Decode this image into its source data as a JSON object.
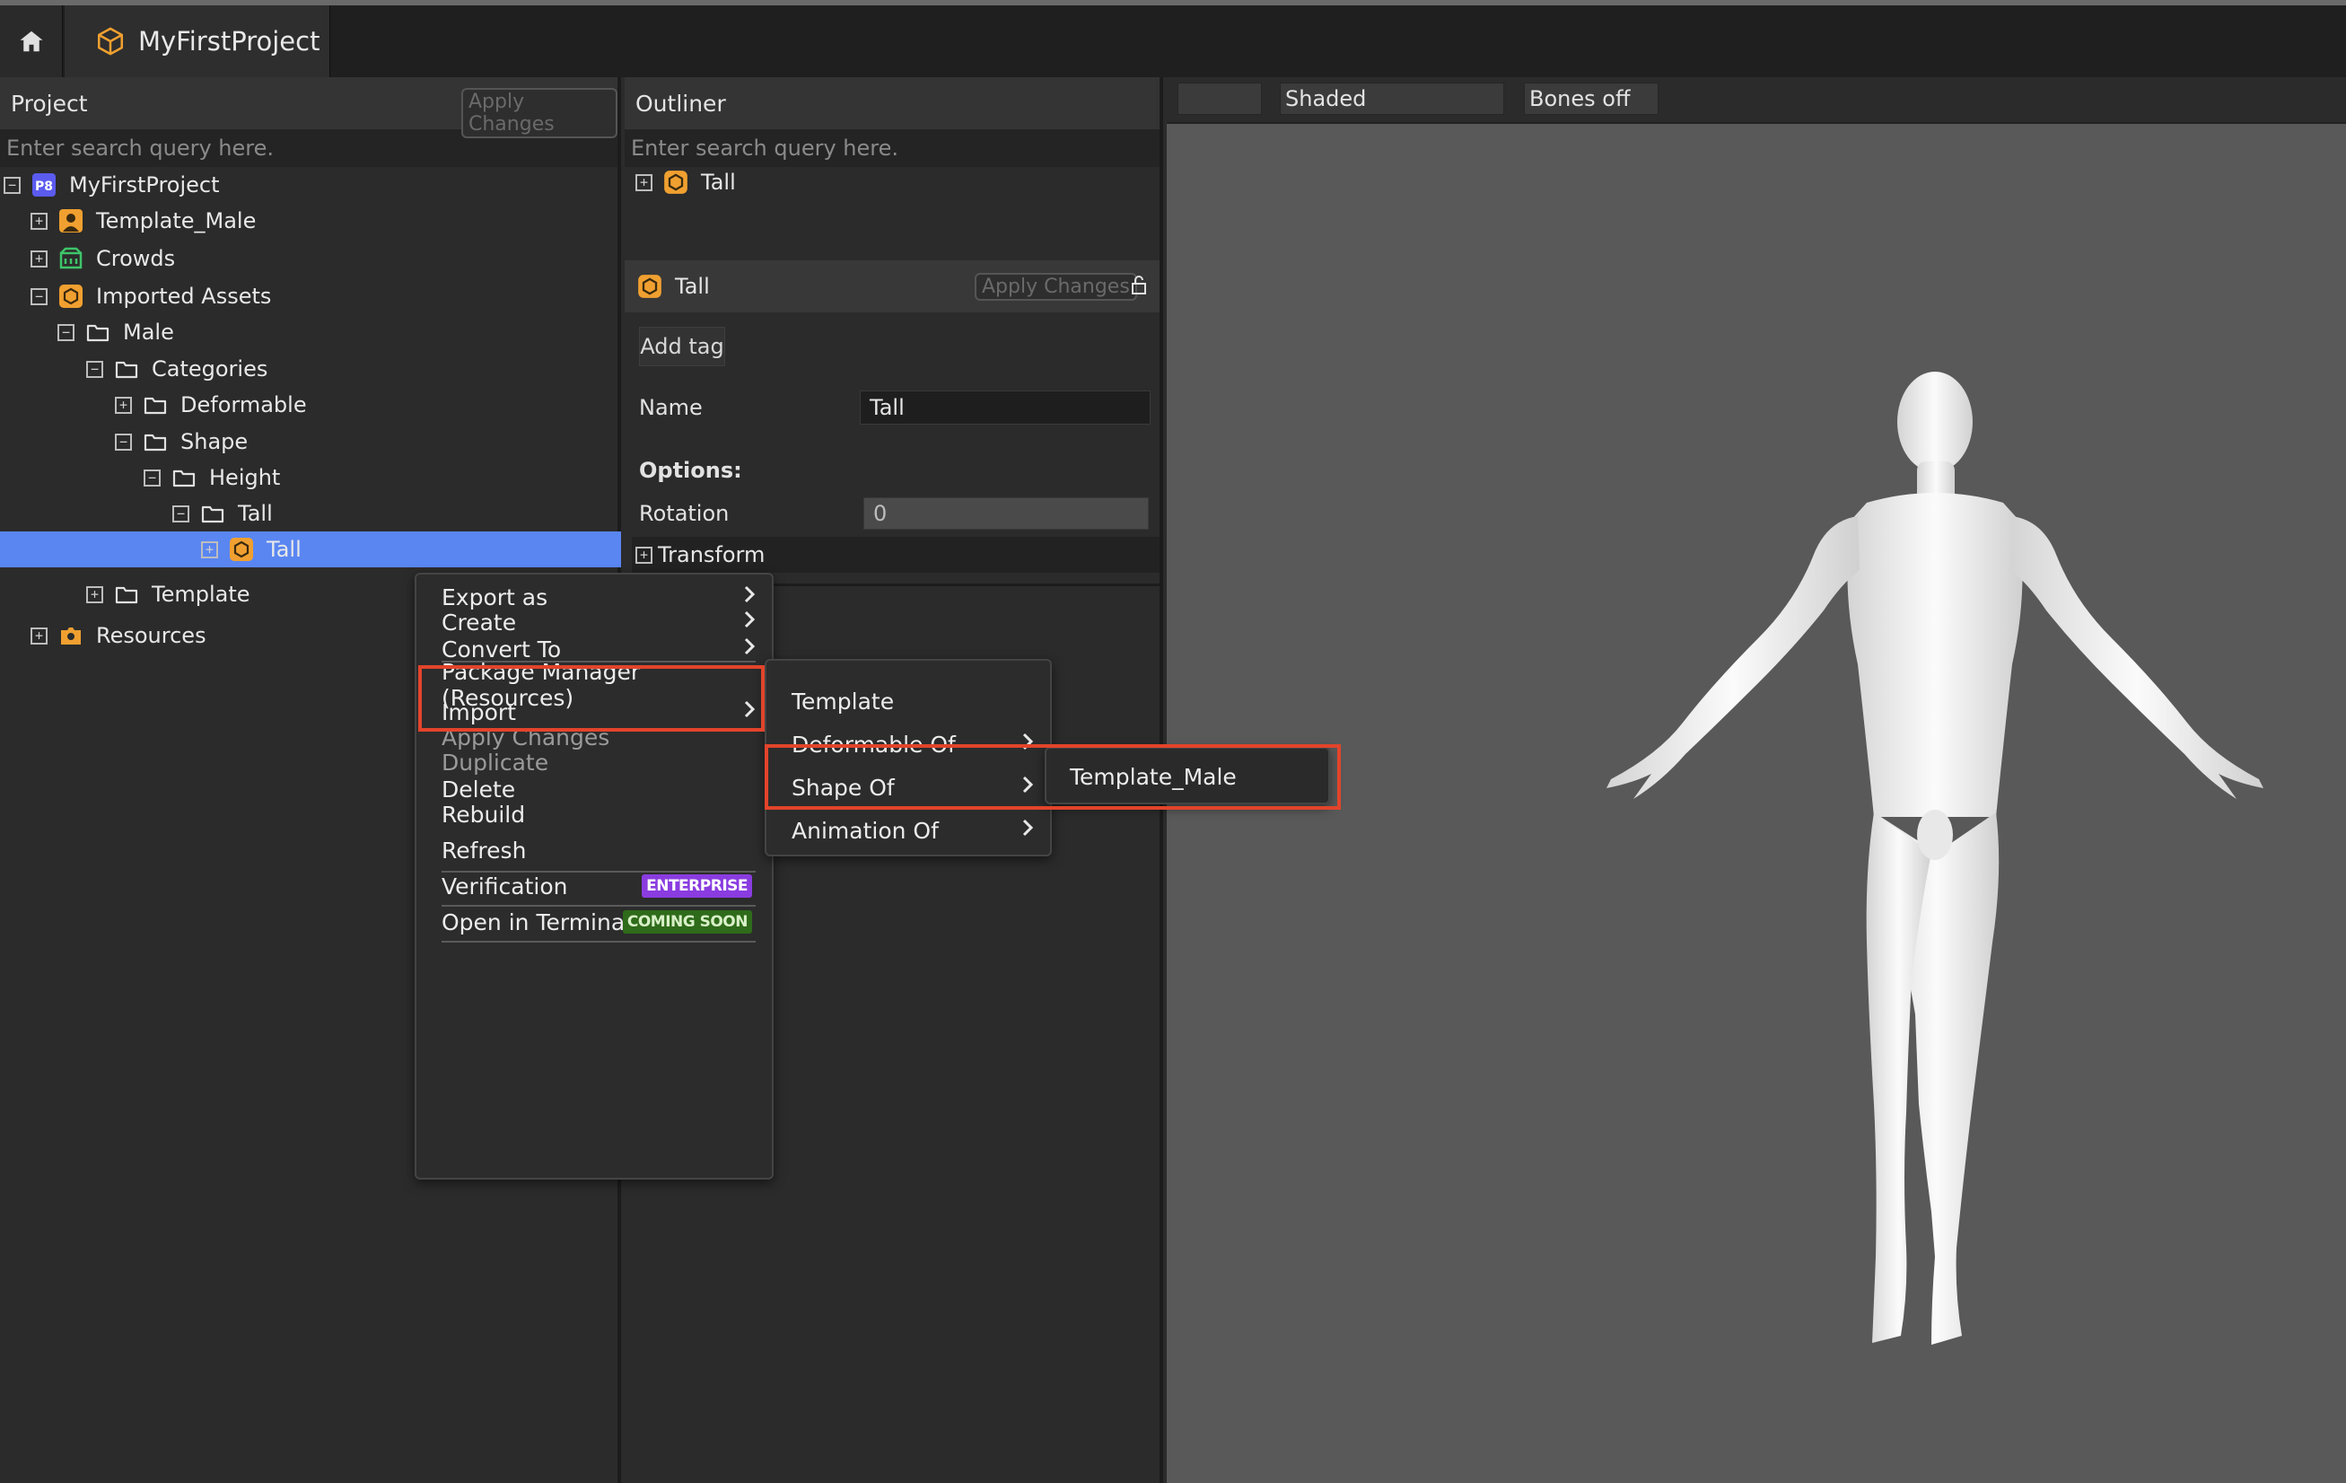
{
  "window": {
    "tab_title": "MyFirstProject"
  },
  "project_panel": {
    "title": "Project",
    "apply_label": "Apply Changes",
    "search_placeholder": "Enter search query here.",
    "tree": [
      {
        "label": "MyFirstProject",
        "icon": "project-p8-icon",
        "expander": "minus"
      },
      {
        "label": "Template_Male",
        "icon": "template-person-icon",
        "expander": "plus"
      },
      {
        "label": "Crowds",
        "icon": "crowds-icon",
        "expander": "plus"
      },
      {
        "label": "Imported Assets",
        "icon": "imported-assets-icon",
        "expander": "minus"
      },
      {
        "label": "Male",
        "icon": "folder-icon",
        "expander": "minus"
      },
      {
        "label": "Categories",
        "icon": "folder-icon",
        "expander": "minus"
      },
      {
        "label": "Deformable",
        "icon": "folder-icon",
        "expander": "plus"
      },
      {
        "label": "Shape",
        "icon": "folder-icon",
        "expander": "minus"
      },
      {
        "label": "Height",
        "icon": "folder-icon",
        "expander": "minus"
      },
      {
        "label": "Tall",
        "icon": "folder-icon",
        "expander": "minus"
      },
      {
        "label": "Tall",
        "icon": "shape-asset-icon",
        "expander": "plus",
        "selected": true
      },
      {
        "label": "Template",
        "icon": "folder-icon",
        "expander": "plus"
      },
      {
        "label": "Resources",
        "icon": "resources-icon",
        "expander": "plus"
      }
    ]
  },
  "outliner": {
    "title": "Outliner",
    "search_placeholder": "Enter search query here.",
    "item_label": "Tall"
  },
  "inspector": {
    "title": "Tall",
    "apply_label": "Apply Changes",
    "add_tag_label": "Add tag",
    "name_label": "Name",
    "name_value": "Tall",
    "options_label": "Options:",
    "rotation_label": "Rotation",
    "rotation_value": "0",
    "transform_label": "Transform"
  },
  "viewport": {
    "shading_label": "Shaded",
    "bones_label": "Bones off"
  },
  "context_menu": {
    "items": [
      {
        "label": "Export as",
        "submenu": true
      },
      {
        "label": "Create",
        "submenu": true
      },
      {
        "label": "Convert To",
        "submenu": true,
        "highlighted": true
      },
      {
        "label": "Package Manager (Resources)"
      },
      {
        "label": "Import",
        "submenu": true
      },
      {
        "label": "Apply Changes",
        "disabled": true
      },
      {
        "label": "Duplicate",
        "disabled": true
      },
      {
        "label": "Delete"
      },
      {
        "label": "Rebuild"
      },
      {
        "label": "Refresh"
      },
      {
        "label": "Verification",
        "badge": "ENTERPRISE"
      },
      {
        "label": "Open in Terminal",
        "badge": "COMING SOON"
      }
    ]
  },
  "convert_submenu": {
    "items": [
      {
        "label": "Template"
      },
      {
        "label": "Deformable Of",
        "submenu": true
      },
      {
        "label": "Shape Of",
        "submenu": true,
        "highlighted": true
      },
      {
        "label": "Animation Of",
        "submenu": true
      }
    ]
  },
  "shape_of_submenu": {
    "items": [
      {
        "label": "Template_Male",
        "highlighted": true
      }
    ]
  },
  "colors": {
    "selection": "#5a86f2",
    "highlight_box": "#e2442b",
    "asset_orange": "#f0a030",
    "enterprise_badge": "#8a3ce0",
    "coming_soon_badge": "#2e6b1a",
    "project_badge": "#5b5bf0"
  }
}
